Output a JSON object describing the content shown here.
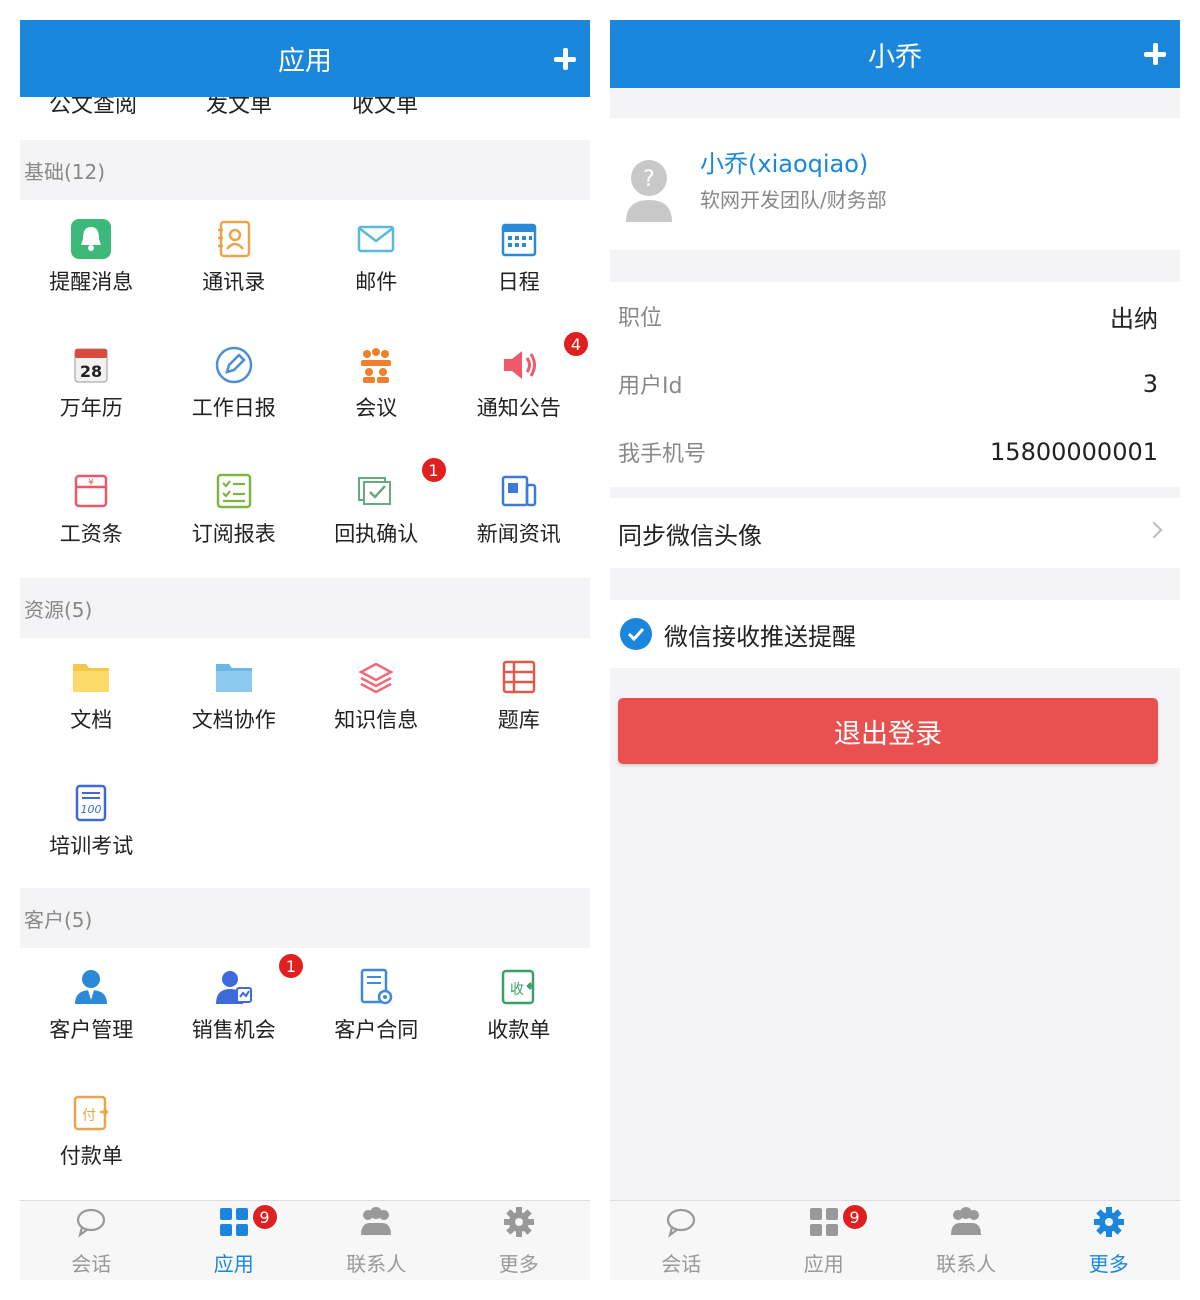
{
  "left": {
    "header": {
      "title": "应用"
    },
    "clipped_row": [
      "公文查阅",
      "发文单",
      "收文单"
    ],
    "sections": [
      {
        "title": "基础(12)",
        "items": [
          {
            "label": "提醒消息",
            "icon": "bell-icon"
          },
          {
            "label": "通讯录",
            "icon": "address-book-icon"
          },
          {
            "label": "邮件",
            "icon": "mail-icon"
          },
          {
            "label": "日程",
            "icon": "schedule-icon"
          },
          {
            "label": "万年历",
            "icon": "calendar-icon",
            "icon_text": "28"
          },
          {
            "label": "工作日报",
            "icon": "pencil-circle-icon"
          },
          {
            "label": "会议",
            "icon": "meeting-icon"
          },
          {
            "label": "通知公告",
            "icon": "speaker-icon",
            "badge": "4"
          },
          {
            "label": "工资条",
            "icon": "salary-icon"
          },
          {
            "label": "订阅报表",
            "icon": "checklist-icon"
          },
          {
            "label": "回执确认",
            "icon": "receipt-icon",
            "badge": "1"
          },
          {
            "label": "新闻资讯",
            "icon": "news-icon"
          }
        ]
      },
      {
        "title": "资源(5)",
        "items": [
          {
            "label": "文档",
            "icon": "folder-yellow-icon"
          },
          {
            "label": "文档协作",
            "icon": "folder-blue-icon"
          },
          {
            "label": "知识信息",
            "icon": "layers-icon"
          },
          {
            "label": "题库",
            "icon": "question-bank-icon"
          },
          {
            "label": "培训考试",
            "icon": "exam-icon",
            "icon_text": "100"
          }
        ]
      },
      {
        "title": "客户(5)",
        "items": [
          {
            "label": "客户管理",
            "icon": "customer-icon"
          },
          {
            "label": "销售机会",
            "icon": "sales-icon",
            "badge": "1"
          },
          {
            "label": "客户合同",
            "icon": "contract-icon"
          },
          {
            "label": "收款单",
            "icon": "receipt-in-icon",
            "icon_text": "收"
          },
          {
            "label": "付款单",
            "icon": "payment-icon",
            "icon_text": "付"
          }
        ]
      }
    ],
    "tabbar": [
      {
        "label": "会话",
        "icon": "chat-icon"
      },
      {
        "label": "应用",
        "icon": "apps-icon",
        "badge": "9",
        "active": true
      },
      {
        "label": "联系人",
        "icon": "contacts-icon"
      },
      {
        "label": "更多",
        "icon": "gear-icon"
      }
    ]
  },
  "right": {
    "header": {
      "title": "小乔"
    },
    "profile": {
      "name": "小乔(xiaoqiao)",
      "org": "软网开发团队/财务部"
    },
    "info": [
      {
        "key": "职位",
        "value": "出纳"
      },
      {
        "key": "用户Id",
        "value": "3"
      },
      {
        "key": "我手机号",
        "value": "15800000001"
      }
    ],
    "sync_label": "同步微信头像",
    "wechat_label": "微信接收推送提醒",
    "logout_label": "退出登录",
    "tabbar": [
      {
        "label": "会话",
        "icon": "chat-icon"
      },
      {
        "label": "应用",
        "icon": "apps-icon",
        "badge": "9"
      },
      {
        "label": "联系人",
        "icon": "contacts-icon"
      },
      {
        "label": "更多",
        "icon": "gear-icon",
        "active": true
      }
    ]
  },
  "colors": {
    "brand": "#1a87dd",
    "danger": "#e8514f",
    "badge": "#e02020"
  }
}
